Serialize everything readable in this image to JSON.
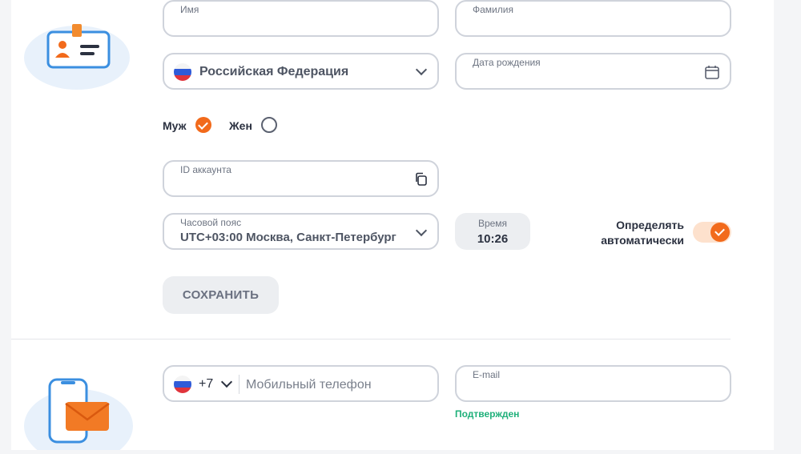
{
  "profile": {
    "first_name": {
      "label": "Имя",
      "value": ""
    },
    "last_name": {
      "label": "Фамилия",
      "value": ""
    },
    "country": {
      "value": "Российская Федерация",
      "icon": "russia-flag-icon"
    },
    "birth_date": {
      "label": "Дата рождения",
      "value": "",
      "icon": "calendar-icon"
    },
    "gender": {
      "options": [
        {
          "label": "Муж",
          "selected": true
        },
        {
          "label": "Жен",
          "selected": false
        }
      ]
    },
    "account_id": {
      "label": "ID аккаунта",
      "value": "",
      "icon": "copy-icon"
    },
    "timezone": {
      "label": "Часовой пояс",
      "value": "UTC+03:00 Москва, Санкт-Петербург"
    },
    "time": {
      "label": "Время",
      "value": "10:26"
    },
    "auto_detect": {
      "label_line1": "Определять",
      "label_line2": "автоматически",
      "enabled": true
    },
    "save_label": "СОХРАНИТЬ"
  },
  "contacts": {
    "phone": {
      "code": "+7",
      "placeholder": "Мобильный телефон",
      "value": ""
    },
    "email": {
      "label": "E-mail",
      "value": "",
      "status": "Подтвержден"
    }
  },
  "colors": {
    "accent": "#f26a1b",
    "success": "#1fb07a",
    "border": "#cfd3db"
  }
}
